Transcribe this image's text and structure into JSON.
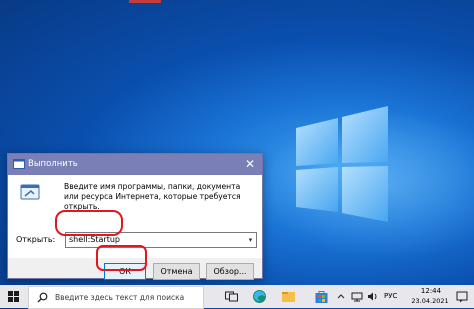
{
  "dialog": {
    "title": "Выполнить",
    "close_glyph": "✕",
    "description": "Введите имя программы, папки, документа или ресурса Интернета, которые требуется открыть.",
    "open_label": "Открыть:",
    "open_value": "shell:Startup",
    "ok_label": "ОК",
    "cancel_label": "Отмена",
    "browse_label": "Обзор..."
  },
  "taskbar": {
    "search_placeholder": "Введите здесь текст для поиска",
    "language": "РУС",
    "time": "12:44",
    "date": "23.04.2021"
  },
  "colors": {
    "titlebar": "#7a7fb6",
    "highlight": "#e0191e",
    "desktop": "#0a4fae"
  }
}
